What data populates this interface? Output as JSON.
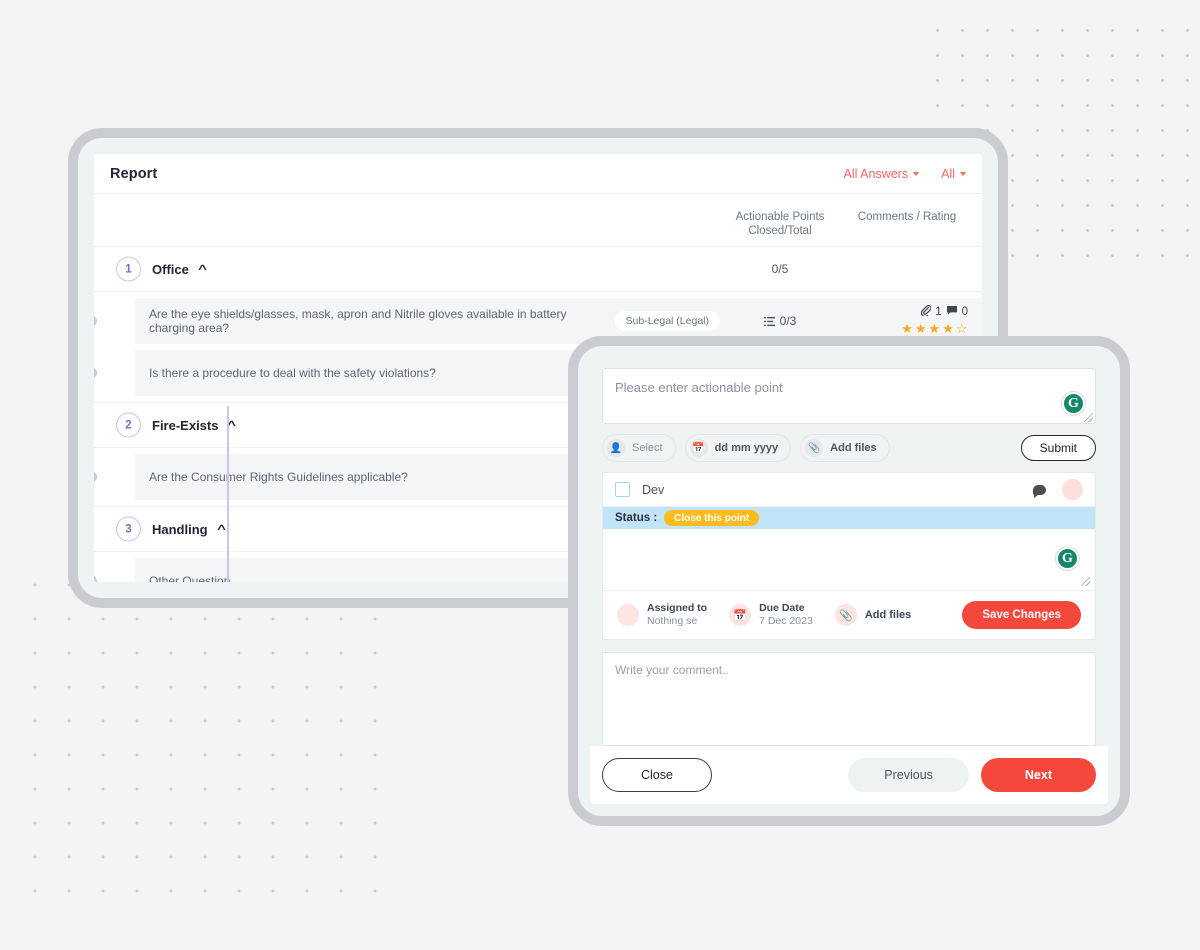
{
  "report": {
    "title": "Report",
    "filters": [
      {
        "label": "All Answers",
        "icon": "chevron-down-icon"
      },
      {
        "label": "All",
        "icon": "chevron-down-icon"
      }
    ],
    "columns": {
      "actionable_points_line1": "Actionable Points",
      "actionable_points_line2": "Closed/Total",
      "comments_rating": "Comments / Rating"
    },
    "sections": [
      {
        "number": "1",
        "name": "Office",
        "chevron": "chevron-up-icon",
        "count": "0/5",
        "questions": [
          {
            "text": "Are the eye shields/glasses, mask, apron and Nitrile gloves available in battery charging area?",
            "tag": "Sub-Legal (Legal)",
            "points": "0/3",
            "attachments": "1",
            "comments": "0",
            "stars_filled": 4,
            "stars_total": 5
          },
          {
            "text": "Is there a procedure to deal with the safety violations?",
            "tag": "",
            "points": "",
            "attachments": "",
            "comments": "",
            "stars_filled": 0,
            "stars_total": 0
          }
        ]
      },
      {
        "number": "2",
        "name": "Fire-Exists",
        "chevron": "chevron-up-icon",
        "count": "",
        "questions": [
          {
            "text": "Are the Consumer Rights Guidelines applicable?",
            "tag": "",
            "points": "",
            "attachments": "",
            "comments": "",
            "stars_filled": 0,
            "stars_total": 0
          }
        ]
      },
      {
        "number": "3",
        "name": "Handling",
        "chevron": "chevron-up-icon",
        "count": "",
        "questions": [
          {
            "text": "Other Question",
            "tag": "",
            "points": "",
            "attachments": "",
            "comments": "",
            "stars_filled": 0,
            "stars_total": 0
          }
        ]
      }
    ]
  },
  "modal": {
    "compose": {
      "placeholder": "Please enter actionable point",
      "grammarly_glyph": "G",
      "assignee_pill": "Select",
      "date_pill": "dd mm yyyy",
      "files_pill": "Add files",
      "submit_label": "Submit"
    },
    "point": {
      "title": "Dev",
      "status_label": "Status :",
      "status_action": "Close this point",
      "grammarly_glyph": "G",
      "assigned_to_label": "Assigned to",
      "assigned_to_value": "Nothing se",
      "due_date_label": "Due Date",
      "due_date_value": "7 Dec 2023",
      "add_files_label": "Add files",
      "save_label": "Save Changes"
    },
    "comment_placeholder": "Write your comment..",
    "footer": {
      "close_label": "Close",
      "previous_label": "Previous",
      "next_label": "Next"
    }
  },
  "colors": {
    "accent_red": "#f4483c",
    "filter_red": "#f4685e",
    "timeline_purple": "#cdc4f0",
    "status_blue": "#c1e4f8",
    "status_pill_yellow": "#fcbc1d",
    "star_orange": "#fba919",
    "grammarly_green": "#15886c"
  }
}
